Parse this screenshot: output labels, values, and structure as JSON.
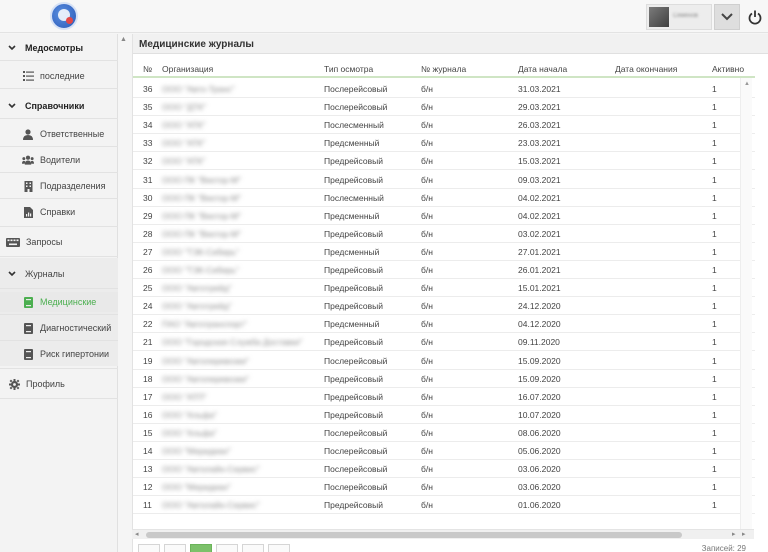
{
  "header": {
    "user_name": "Семёнов",
    "colors": {
      "accent": "#4caf50"
    }
  },
  "sidebar": {
    "groups": [
      {
        "label": "Медосмотры",
        "items": [
          {
            "label": "последние",
            "icon": "list-icon"
          }
        ]
      },
      {
        "label": "Справочники",
        "items": [
          {
            "label": "Ответственные",
            "icon": "person-icon"
          },
          {
            "label": "Водители",
            "icon": "group-icon"
          },
          {
            "label": "Подразделения",
            "icon": "building-icon"
          },
          {
            "label": "Справки",
            "icon": "file-chart-icon"
          }
        ]
      },
      {
        "label": "Запросы",
        "icon": "keyboard-icon"
      },
      {
        "label": "Журналы",
        "items": [
          {
            "label": "Медицинские",
            "icon": "book-icon"
          },
          {
            "label": "Диагностический",
            "icon": "book-icon"
          },
          {
            "label": "Риск гипертонии",
            "icon": "book-icon"
          }
        ]
      },
      {
        "label": "Профиль",
        "icon": "gear-icon"
      }
    ]
  },
  "panel": {
    "title": "Медицинские журналы",
    "columns": [
      "№",
      "Организация",
      "Тип осмотра",
      "№ журнала",
      "Дата начала",
      "Дата окончания",
      "Активно"
    ],
    "rows": [
      {
        "n": "36",
        "org": "ООО \"Авто-Транс\"",
        "type": "Послерейсовый",
        "journal": "б/н",
        "start": "31.03.2021",
        "end": "",
        "active": "1"
      },
      {
        "n": "35",
        "org": "ООО \"ДТК\"",
        "type": "Послерейсовый",
        "journal": "б/н",
        "start": "29.03.2021",
        "end": "",
        "active": "1"
      },
      {
        "n": "34",
        "org": "ООО \"АТК\"",
        "type": "Послесменный",
        "journal": "б/н",
        "start": "26.03.2021",
        "end": "",
        "active": "1"
      },
      {
        "n": "33",
        "org": "ООО \"АТК\"",
        "type": "Предсменный",
        "journal": "б/н",
        "start": "23.03.2021",
        "end": "",
        "active": "1"
      },
      {
        "n": "32",
        "org": "ООО \"АТК\"",
        "type": "Предрейсовый",
        "journal": "б/н",
        "start": "15.03.2021",
        "end": "",
        "active": "1"
      },
      {
        "n": "31",
        "org": "ООО ПК \"Вектор-М\"",
        "type": "Предрейсовый",
        "journal": "б/н",
        "start": "09.03.2021",
        "end": "",
        "active": "1"
      },
      {
        "n": "30",
        "org": "ООО ПК \"Вектор-М\"",
        "type": "Послесменный",
        "journal": "б/н",
        "start": "04.02.2021",
        "end": "",
        "active": "1"
      },
      {
        "n": "29",
        "org": "ООО ПК \"Вектор-М\"",
        "type": "Предсменный",
        "journal": "б/н",
        "start": "04.02.2021",
        "end": "",
        "active": "1"
      },
      {
        "n": "28",
        "org": "ООО ПК \"Вектор-М\"",
        "type": "Предрейсовый",
        "journal": "б/н",
        "start": "03.02.2021",
        "end": "",
        "active": "1"
      },
      {
        "n": "27",
        "org": "ООО \"ТЭК-Сибирь\"",
        "type": "Предсменный",
        "journal": "б/н",
        "start": "27.01.2021",
        "end": "",
        "active": "1"
      },
      {
        "n": "26",
        "org": "ООО \"ТЭК-Сибирь\"",
        "type": "Предрейсовый",
        "journal": "б/н",
        "start": "26.01.2021",
        "end": "",
        "active": "1"
      },
      {
        "n": "25",
        "org": "ООО \"Автотрейд\"",
        "type": "Предрейсовый",
        "journal": "б/н",
        "start": "15.01.2021",
        "end": "",
        "active": "1"
      },
      {
        "n": "24",
        "org": "ООО \"Автотрейд\"",
        "type": "Предрейсовый",
        "journal": "б/н",
        "start": "24.12.2020",
        "end": "",
        "active": "1"
      },
      {
        "n": "22",
        "org": "ПАО \"Автотранспорт\"",
        "type": "Предсменный",
        "journal": "б/н",
        "start": "04.12.2020",
        "end": "",
        "active": "1"
      },
      {
        "n": "21",
        "org": "ООО \"Городская Служба Доставки\"",
        "type": "Предрейсовый",
        "journal": "б/н",
        "start": "09.11.2020",
        "end": "",
        "active": "1"
      },
      {
        "n": "19",
        "org": "ООО \"Автоперевозки\"",
        "type": "Послерейсовый",
        "journal": "б/н",
        "start": "15.09.2020",
        "end": "",
        "active": "1"
      },
      {
        "n": "18",
        "org": "ООО \"Автоперевозки\"",
        "type": "Предрейсовый",
        "journal": "б/н",
        "start": "15.09.2020",
        "end": "",
        "active": "1"
      },
      {
        "n": "17",
        "org": "ООО \"АТП\"",
        "type": "Предрейсовый",
        "journal": "б/н",
        "start": "16.07.2020",
        "end": "",
        "active": "1"
      },
      {
        "n": "16",
        "org": "ООО \"Альфа\"",
        "type": "Предрейсовый",
        "journal": "б/н",
        "start": "10.07.2020",
        "end": "",
        "active": "1"
      },
      {
        "n": "15",
        "org": "ООО \"Альфа\"",
        "type": "Послерейсовый",
        "journal": "б/н",
        "start": "08.06.2020",
        "end": "",
        "active": "1"
      },
      {
        "n": "14",
        "org": "ООО \"Меридиан\"",
        "type": "Послерейсовый",
        "journal": "б/н",
        "start": "05.06.2020",
        "end": "",
        "active": "1"
      },
      {
        "n": "13",
        "org": "ООО \"Автолайн-Сервис\"",
        "type": "Послерейсовый",
        "journal": "б/н",
        "start": "03.06.2020",
        "end": "",
        "active": "1"
      },
      {
        "n": "12",
        "org": "ООО \"Меридиан\"",
        "type": "Послерейсовый",
        "journal": "б/н",
        "start": "03.06.2020",
        "end": "",
        "active": "1"
      },
      {
        "n": "11",
        "org": "ООО \"Автолайн-Сервис\"",
        "type": "Предрейсовый",
        "journal": "б/н",
        "start": "01.06.2020",
        "end": "",
        "active": "1"
      }
    ],
    "records_label": "Записей: 29"
  }
}
